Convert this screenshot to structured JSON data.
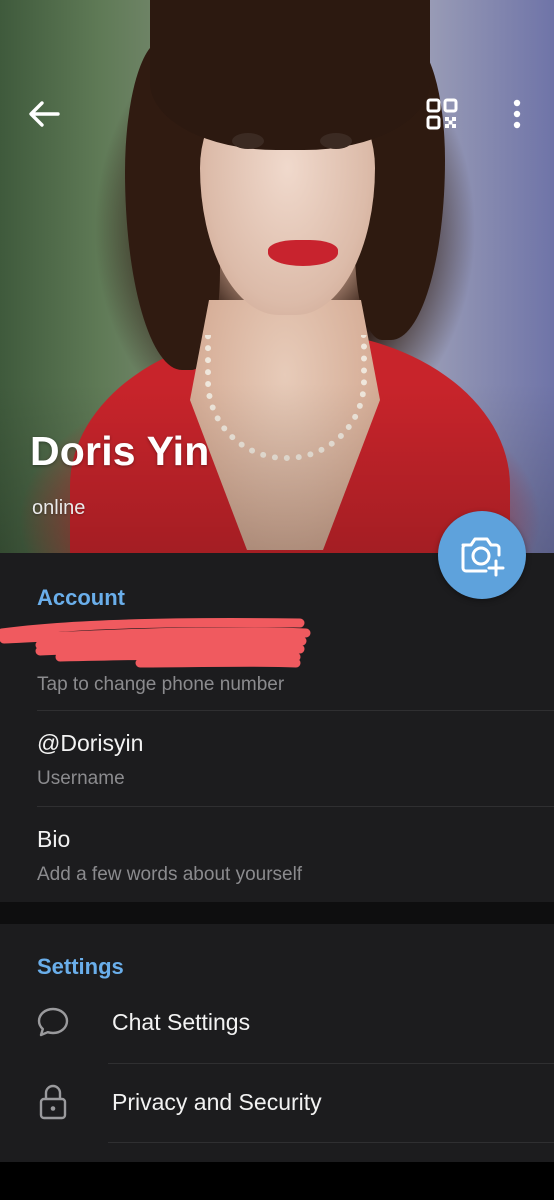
{
  "profile": {
    "name": "Doris Yin",
    "status": "online"
  },
  "account": {
    "section_title": "Account",
    "phone_hint": "Tap to change phone number",
    "username_value": "@Dorisyin",
    "username_label": "Username",
    "bio_label": "Bio",
    "bio_hint": "Add a few words about yourself"
  },
  "settings": {
    "section_title": "Settings",
    "items": [
      {
        "label": "Chat Settings",
        "icon": "chat-bubble-icon"
      },
      {
        "label": "Privacy and Security",
        "icon": "lock-icon"
      }
    ]
  },
  "icons": {
    "back": "back-arrow-icon",
    "qr": "qr-code-icon",
    "more": "more-vert-icon",
    "camera": "add-photo-icon"
  },
  "colors": {
    "accent": "#6aaeea",
    "fab": "#5ea2dc",
    "panel": "#1c1c1e",
    "redaction": "#f05a5f"
  }
}
